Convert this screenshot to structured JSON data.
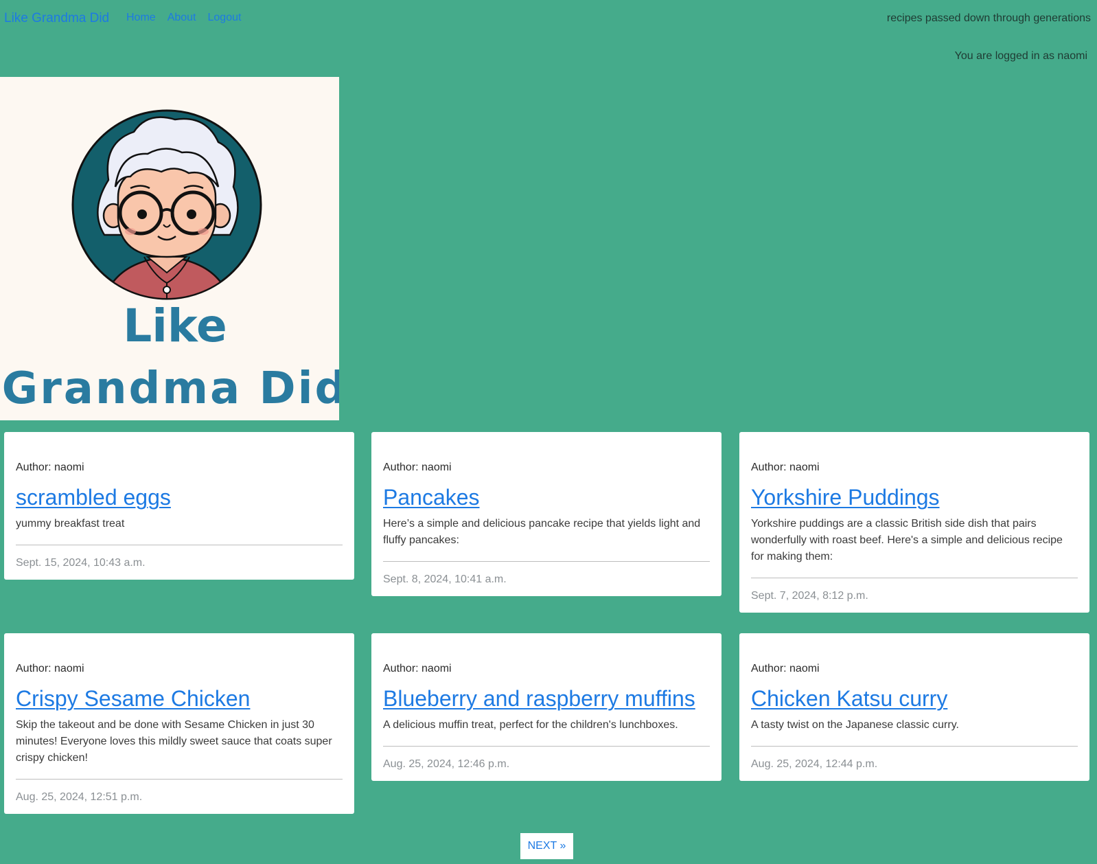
{
  "navbar": {
    "brand": "Like Grandma Did",
    "links": [
      {
        "label": "Home"
      },
      {
        "label": "About"
      },
      {
        "label": "Logout"
      }
    ],
    "tagline": "recipes passed down through generations"
  },
  "login_status": "You are logged in as naomi",
  "hero": {
    "logo_text_line1": "Like",
    "logo_text_line2": "Grandma Did"
  },
  "recipes": [
    {
      "author": "Author: naomi",
      "title": "scrambled eggs",
      "description": "yummy breakfast treat",
      "date": "Sept. 15, 2024, 10:43 a.m."
    },
    {
      "author": "Author: naomi",
      "title": "Pancakes",
      "description": "Here’s a simple and delicious pancake recipe that yields light and fluffy pancakes:",
      "date": "Sept. 8, 2024, 10:41 a.m."
    },
    {
      "author": "Author: naomi",
      "title": "Yorkshire Puddings",
      "description": "Yorkshire puddings are a classic British side dish that pairs wonderfully with roast beef. Here's a simple and delicious recipe for making them:",
      "date": "Sept. 7, 2024, 8:12 p.m."
    },
    {
      "author": "Author: naomi",
      "title": "Crispy Sesame Chicken",
      "description": "Skip the takeout and be done with Sesame Chicken in just 30 minutes! Everyone loves this mildly sweet sauce that coats super crispy chicken!",
      "date": "Aug. 25, 2024, 12:51 p.m."
    },
    {
      "author": "Author: naomi",
      "title": "Blueberry and raspberry muffins",
      "description": "A delicious muffin treat, perfect for the children's lunchboxes.",
      "date": "Aug. 25, 2024, 12:46 p.m."
    },
    {
      "author": "Author: naomi",
      "title": "Chicken Katsu curry",
      "description": "A tasty twist on the Japanese classic curry.",
      "date": "Aug. 25, 2024, 12:44 p.m."
    }
  ],
  "pagination": {
    "next_label": "NEXT »"
  },
  "colors": {
    "background": "#45ab8b",
    "link": "#1d7ae3",
    "logo_text": "#2a7ba0",
    "logo_circle": "#135f6b",
    "hero_bg": "#fdf8f2"
  }
}
